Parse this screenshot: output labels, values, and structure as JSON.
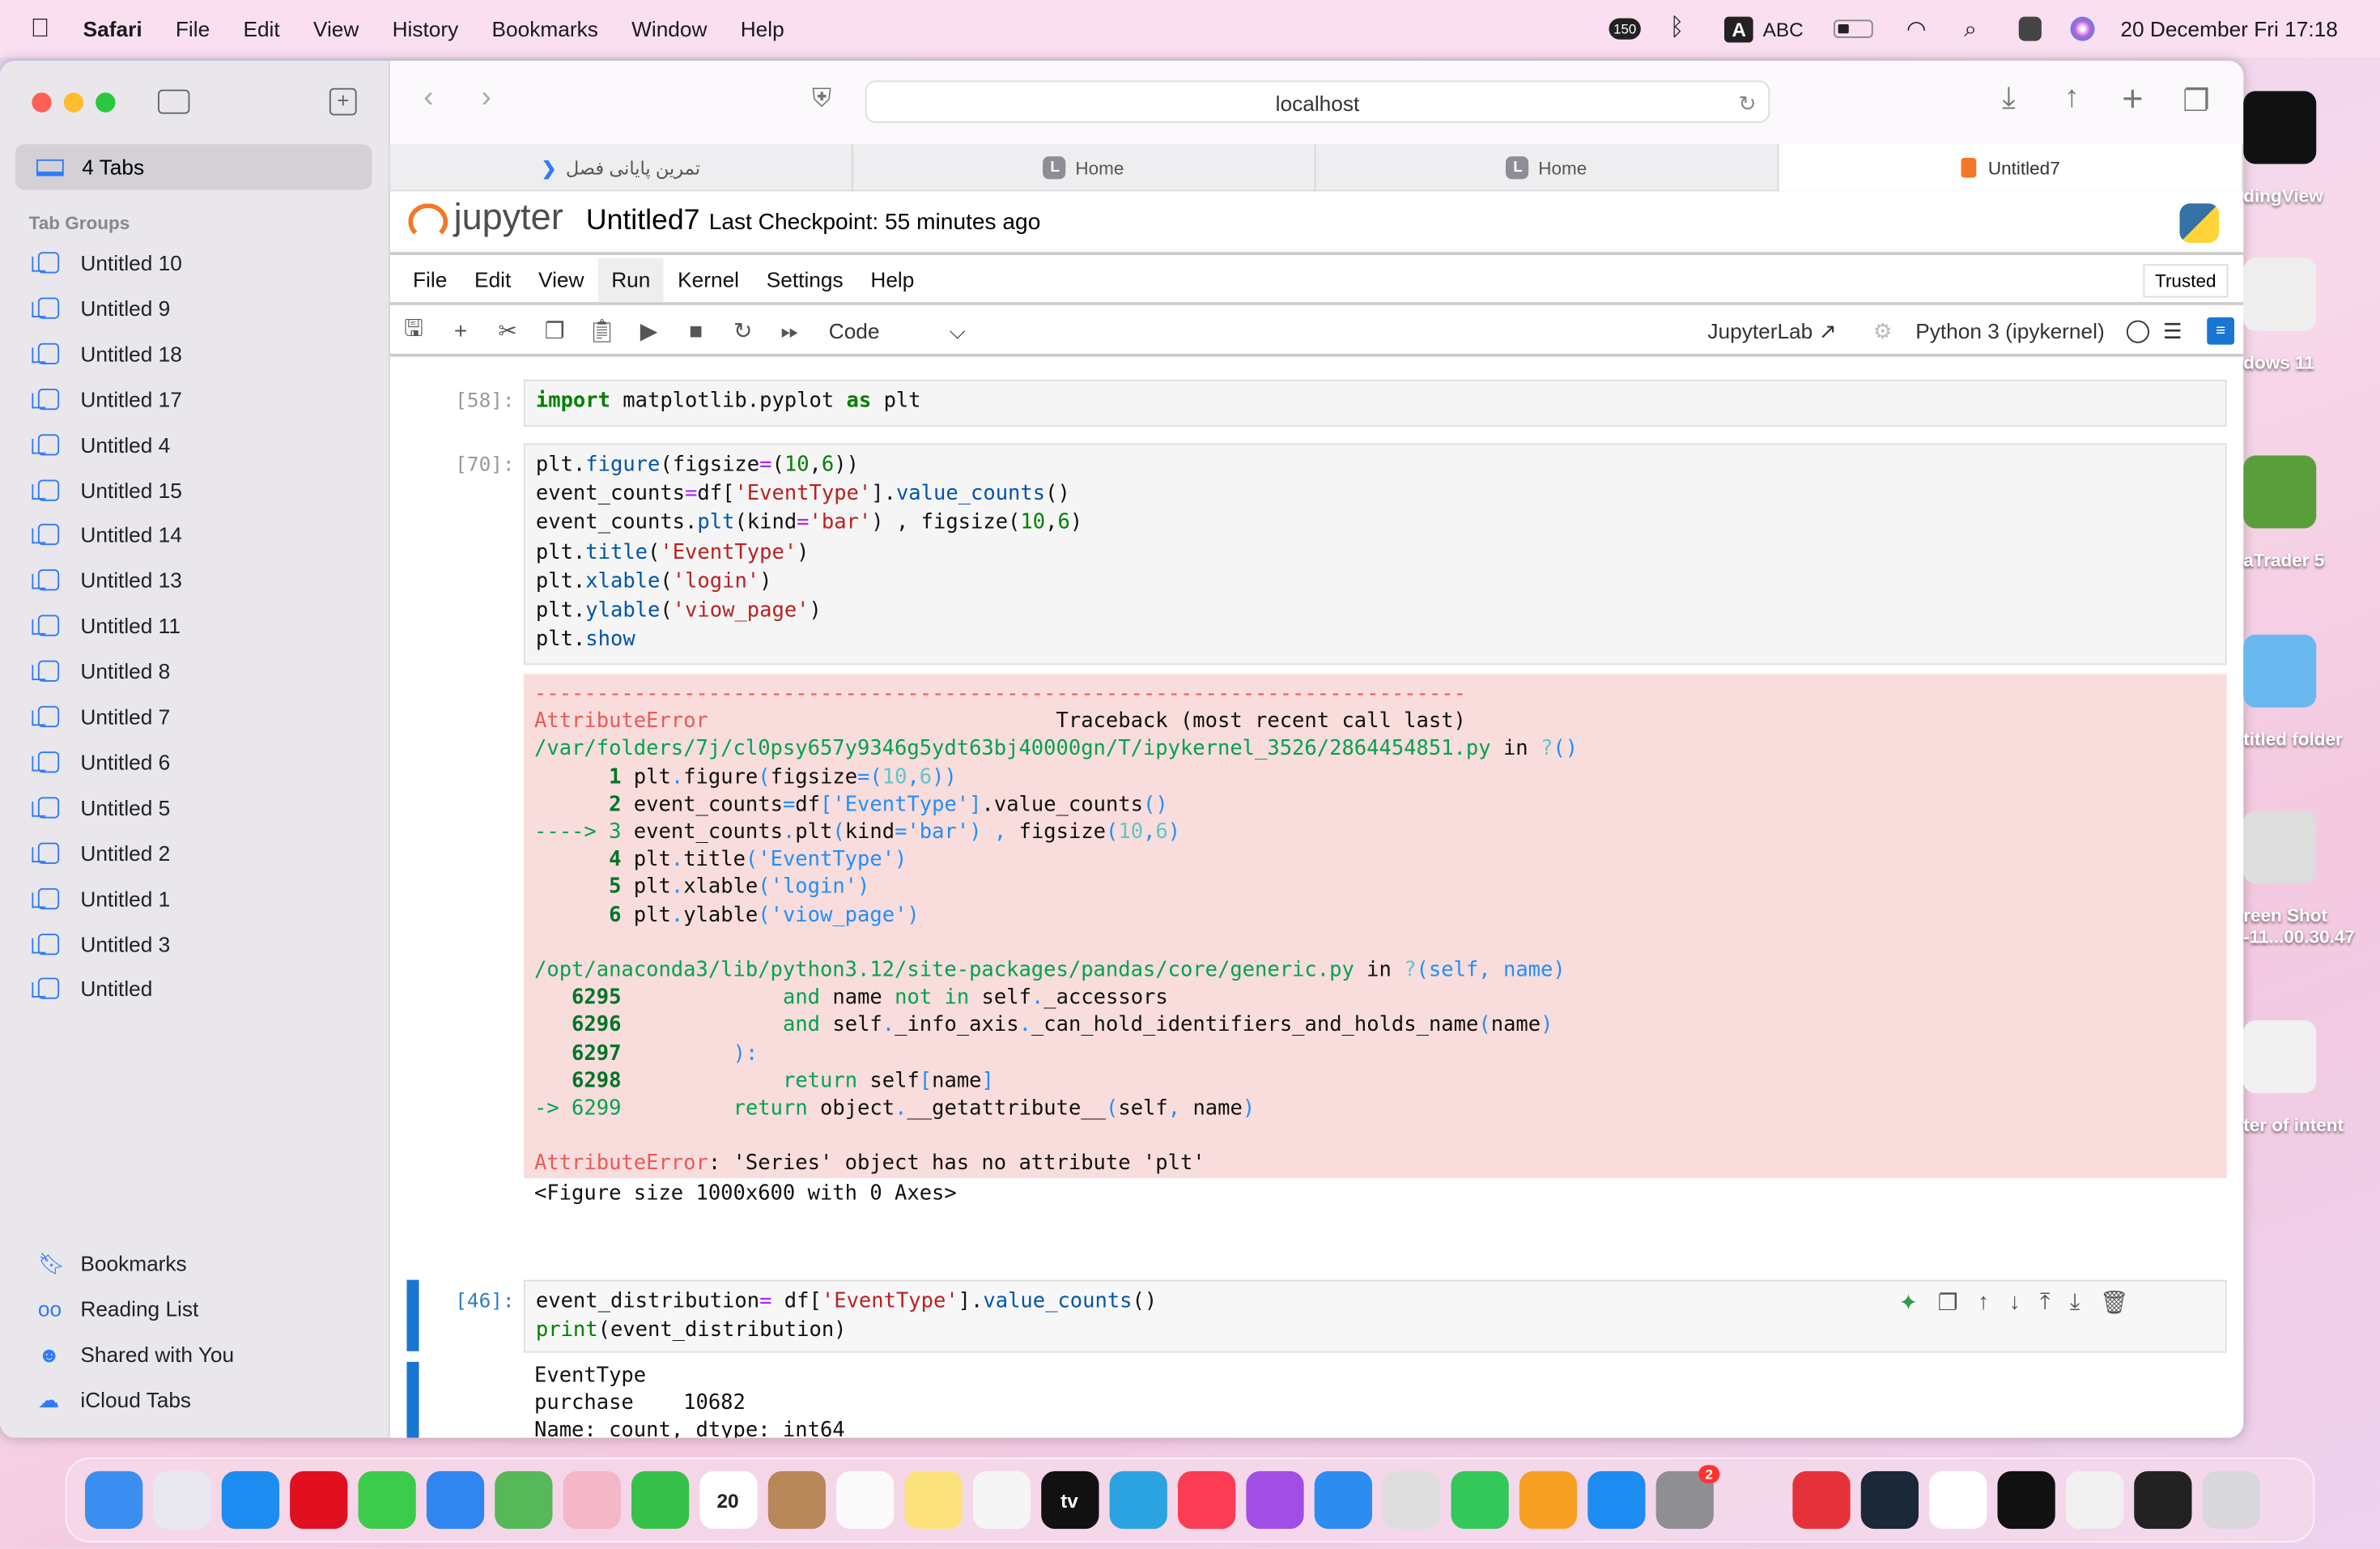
{
  "menubar": {
    "app": "Safari",
    "items": [
      "File",
      "Edit",
      "View",
      "History",
      "Bookmarks",
      "Window",
      "Help"
    ],
    "status": {
      "badge": "150",
      "input_source": "A",
      "input_label": "ABC",
      "datetime": "20 December Fri  17:18"
    }
  },
  "sidebar": {
    "tabs_count": "4 Tabs",
    "section": "Tab Groups",
    "groups": [
      "Untitled 10",
      "Untitled 9",
      "Untitled 18",
      "Untitled 17",
      "Untitled 4",
      "Untitled 15",
      "Untitled 14",
      "Untitled 13",
      "Untitled 11",
      "Untitled 8",
      "Untitled 7",
      "Untitled 6",
      "Untitled 5",
      "Untitled 2",
      "Untitled 1",
      "Untitled 3",
      "Untitled"
    ],
    "bottom": [
      "Bookmarks",
      "Reading List",
      "Shared with You",
      "iCloud Tabs"
    ]
  },
  "browser": {
    "url": "localhost",
    "tabs": [
      {
        "label": "تمرین پایانی فصل",
        "icon": "chevron-icon"
      },
      {
        "label": "Home",
        "icon": "L"
      },
      {
        "label": "Home",
        "icon": "L"
      },
      {
        "label": "Untitled7",
        "icon": "notebook-icon",
        "active": true
      }
    ]
  },
  "jupyter": {
    "logo": "jupyter",
    "title": "Untitled7",
    "checkpoint": "Last Checkpoint: 55 minutes ago",
    "menu": [
      "File",
      "Edit",
      "View",
      "Run",
      "Kernel",
      "Settings",
      "Help"
    ],
    "menu_active": "Run",
    "trusted": "Trusted",
    "cell_type": "Code",
    "jupyterlab": "JupyterLab",
    "kernel": "Python 3 (ipykernel)"
  },
  "cells": [
    {
      "prompt": "[58]:",
      "code": [
        [
          [
            "import",
            "k"
          ],
          [
            " matplotlib.pyplot ",
            ""
          ],
          [
            "as",
            "k"
          ],
          [
            " plt",
            ""
          ]
        ]
      ]
    },
    {
      "prompt": "[70]:",
      "code": [
        [
          [
            "plt.",
            ""
          ],
          [
            "figure",
            "f"
          ],
          [
            "(figsize",
            ""
          ],
          [
            "=",
            "o"
          ],
          [
            "(",
            ""
          ],
          [
            "10",
            "n"
          ],
          [
            ",",
            ""
          ],
          [
            "6",
            "n"
          ],
          [
            "))",
            ""
          ]
        ],
        [
          [
            "event_counts",
            ""
          ],
          [
            "=",
            "o"
          ],
          [
            "df[",
            ""
          ],
          [
            "'EventType'",
            "s"
          ],
          [
            "].",
            ""
          ],
          [
            "value_counts",
            "f"
          ],
          [
            "()",
            ""
          ]
        ],
        [
          [
            "event_counts.",
            ""
          ],
          [
            "plt",
            "f"
          ],
          [
            "(kind",
            ""
          ],
          [
            "=",
            "o"
          ],
          [
            "'bar'",
            "s"
          ],
          [
            ") , figsize(",
            ""
          ],
          [
            "10",
            "n"
          ],
          [
            ",",
            ""
          ],
          [
            "6",
            "n"
          ],
          [
            ")",
            ""
          ]
        ],
        [
          [
            "plt.",
            ""
          ],
          [
            "title",
            "f"
          ],
          [
            "(",
            ""
          ],
          [
            "'EventType'",
            "s"
          ],
          [
            ")",
            ""
          ]
        ],
        [
          [
            "plt.",
            ""
          ],
          [
            "xlable",
            "f"
          ],
          [
            "(",
            ""
          ],
          [
            "'login'",
            "s"
          ],
          [
            ")",
            ""
          ]
        ],
        [
          [
            "plt.",
            ""
          ],
          [
            "ylable",
            "f"
          ],
          [
            "(",
            ""
          ],
          [
            "'viow_page'",
            "s"
          ],
          [
            ")",
            ""
          ]
        ],
        [
          [
            "plt.",
            ""
          ],
          [
            "show",
            "f"
          ]
        ]
      ],
      "error": [
        [
          [
            "---------------------------------------------------------------------------",
            "r"
          ]
        ],
        [
          [
            "AttributeError",
            "r"
          ],
          [
            "                            Traceback (most recent call last)",
            ""
          ]
        ],
        [
          [
            "/var/folders/7j/cl0psy657y9346g5ydt63bj40000gn/T/ipykernel_3526/2864454851.py",
            "g"
          ],
          [
            " in ",
            ""
          ],
          [
            "?",
            "c"
          ],
          [
            "()",
            "b"
          ]
        ],
        [
          [
            "      ",
            ""
          ],
          [
            "1",
            "gb"
          ],
          [
            " plt",
            ""
          ],
          [
            ".",
            "b"
          ],
          [
            "figure",
            ""
          ],
          [
            "(",
            "b"
          ],
          [
            "figsize",
            ""
          ],
          [
            "=(",
            "b"
          ],
          [
            "10",
            "c"
          ],
          [
            ",",
            "b"
          ],
          [
            "6",
            "c"
          ],
          [
            "))",
            "b"
          ]
        ],
        [
          [
            "      ",
            ""
          ],
          [
            "2",
            "gb"
          ],
          [
            " event_counts",
            ""
          ],
          [
            "=",
            "b"
          ],
          [
            "df",
            ""
          ],
          [
            "['EventType']",
            "b"
          ],
          [
            ".value_counts",
            ""
          ],
          [
            "()",
            "b"
          ]
        ],
        [
          [
            "----> ",
            "g"
          ],
          [
            "3",
            "g"
          ],
          [
            " event_counts",
            ""
          ],
          [
            ".",
            "b"
          ],
          [
            "plt",
            ""
          ],
          [
            "(",
            "b"
          ],
          [
            "kind",
            ""
          ],
          [
            "=",
            "b"
          ],
          [
            "'bar'",
            "b"
          ],
          [
            ")",
            "b"
          ],
          [
            " , ",
            "b"
          ],
          [
            "figsize",
            ""
          ],
          [
            "(",
            "b"
          ],
          [
            "10",
            "c"
          ],
          [
            ",",
            "b"
          ],
          [
            "6",
            "c"
          ],
          [
            ")",
            "b"
          ]
        ],
        [
          [
            "      ",
            ""
          ],
          [
            "4",
            "gb"
          ],
          [
            " plt",
            ""
          ],
          [
            ".",
            "b"
          ],
          [
            "title",
            ""
          ],
          [
            "('EventType')",
            "b"
          ]
        ],
        [
          [
            "      ",
            ""
          ],
          [
            "5",
            "gb"
          ],
          [
            " plt",
            ""
          ],
          [
            ".",
            "b"
          ],
          [
            "xlable",
            ""
          ],
          [
            "('login')",
            "b"
          ]
        ],
        [
          [
            "      ",
            ""
          ],
          [
            "6",
            "gb"
          ],
          [
            " plt",
            ""
          ],
          [
            ".",
            "b"
          ],
          [
            "ylable",
            ""
          ],
          [
            "('viow_page')",
            "b"
          ]
        ],
        [
          [
            "",
            ""
          ]
        ],
        [
          [
            "/opt/anaconda3/lib/python3.12/site-packages/pandas/core/generic.py",
            "g"
          ],
          [
            " in ",
            ""
          ],
          [
            "?",
            "c"
          ],
          [
            "(self, name)",
            "b"
          ]
        ],
        [
          [
            "   ",
            ""
          ],
          [
            "6295",
            "gb"
          ],
          [
            "             ",
            ""
          ],
          [
            "and",
            "g"
          ],
          [
            " name ",
            ""
          ],
          [
            "not",
            "g"
          ],
          [
            " ",
            ""
          ],
          [
            "in",
            "g"
          ],
          [
            " self",
            ""
          ],
          [
            ".",
            "b"
          ],
          [
            "_accessors",
            ""
          ]
        ],
        [
          [
            "   ",
            ""
          ],
          [
            "6296",
            "gb"
          ],
          [
            "             ",
            ""
          ],
          [
            "and",
            "g"
          ],
          [
            " self",
            ""
          ],
          [
            ".",
            "b"
          ],
          [
            "_info_axis",
            ""
          ],
          [
            ".",
            "b"
          ],
          [
            "_can_hold_identifiers_and_holds_name",
            ""
          ],
          [
            "(",
            "b"
          ],
          [
            "name",
            ""
          ],
          [
            ")",
            "b"
          ]
        ],
        [
          [
            "   ",
            ""
          ],
          [
            "6297",
            "gb"
          ],
          [
            "         ",
            ""
          ],
          [
            "):",
            "b"
          ]
        ],
        [
          [
            "   ",
            ""
          ],
          [
            "6298",
            "gb"
          ],
          [
            "             ",
            ""
          ],
          [
            "return",
            "g"
          ],
          [
            " self",
            ""
          ],
          [
            "[",
            "b"
          ],
          [
            "name",
            ""
          ],
          [
            "]",
            "b"
          ]
        ],
        [
          [
            "-> ",
            "g"
          ],
          [
            "6299",
            "g"
          ],
          [
            "         ",
            ""
          ],
          [
            "return",
            "g"
          ],
          [
            " object",
            ""
          ],
          [
            ".",
            "b"
          ],
          [
            "__getattribute__",
            ""
          ],
          [
            "(",
            "b"
          ],
          [
            "self",
            ""
          ],
          [
            ",",
            "b"
          ],
          [
            " name",
            ""
          ],
          [
            ")",
            "b"
          ]
        ],
        [
          [
            "",
            ""
          ]
        ],
        [
          [
            "AttributeError",
            "r"
          ],
          [
            ": 'Series' object has no attribute 'plt'",
            ""
          ]
        ]
      ],
      "output": "<Figure size 1000x600 with 0 Axes>"
    },
    {
      "prompt": "[46]:",
      "code": [
        [
          [
            "event_distribution",
            ""
          ],
          [
            "=",
            "o"
          ],
          [
            " df[",
            ""
          ],
          [
            "'EventType'",
            "s"
          ],
          [
            "].",
            ""
          ],
          [
            "value_counts",
            "f"
          ],
          [
            "()",
            ""
          ]
        ],
        [
          [
            "print",
            "n"
          ],
          [
            "(event_distribution)",
            ""
          ]
        ]
      ],
      "output": "EventType\npurchase    10682\nName: count, dtype: int64"
    },
    {
      "prompt": "[ ]:",
      "code": []
    }
  ],
  "desktop": [
    "dingView",
    "dows 11",
    "aTrader 5",
    "titled folder",
    "reen Shot\n-11...00.30.47",
    "ter of intent"
  ],
  "dock": [
    {
      "name": "Finder",
      "color": "#3a8ef0"
    },
    {
      "name": "Launchpad",
      "color": "#e8e8ee"
    },
    {
      "name": "Safari",
      "color": "#1d8cf0"
    },
    {
      "name": "Opera",
      "color": "#e01020"
    },
    {
      "name": "Messages",
      "color": "#3ccb4c"
    },
    {
      "name": "Mail",
      "color": "#2f86f0"
    },
    {
      "name": "Maps",
      "color": "#57b85a"
    },
    {
      "name": "Photos",
      "color": "#f4b7c8"
    },
    {
      "name": "FaceTime",
      "color": "#36c24a"
    },
    {
      "name": "Calendar",
      "color": "#ffffff",
      "label": "20"
    },
    {
      "name": "Contacts",
      "color": "#b8875a"
    },
    {
      "name": "Reminders",
      "color": "#fafafa"
    },
    {
      "name": "Notes",
      "color": "#fbe27a"
    },
    {
      "name": "Freeform",
      "color": "#f5f5f5"
    },
    {
      "name": "TV",
      "color": "#111111",
      "label": "tv"
    },
    {
      "name": "Telegram",
      "color": "#2aa3e0"
    },
    {
      "name": "Music",
      "color": "#fb3c54"
    },
    {
      "name": "Podcasts",
      "color": "#a14ee6"
    },
    {
      "name": "Keynote",
      "color": "#2c8cf0"
    },
    {
      "name": "Tips",
      "color": "#dddddd"
    },
    {
      "name": "Numbers",
      "color": "#34c759"
    },
    {
      "name": "Pages",
      "color": "#f7a024"
    },
    {
      "name": "App Store",
      "color": "#1d8cf0"
    },
    {
      "name": "System Settings",
      "color": "#8e8e93",
      "badge": "2"
    },
    {
      "name": "Rocket",
      "color": "transparent"
    },
    {
      "name": "Spark Mail",
      "color": "#e5323a"
    },
    {
      "name": "Steam",
      "color": "#1b2838"
    },
    {
      "name": "VS Code",
      "color": "#ffffff"
    },
    {
      "name": "Terminal",
      "color": "#111111"
    },
    {
      "name": "Recent 1",
      "color": "#f0f0f0"
    },
    {
      "name": "Recent 2",
      "color": "#222222"
    },
    {
      "name": "Trash",
      "color": "#d8d8dc"
    }
  ]
}
